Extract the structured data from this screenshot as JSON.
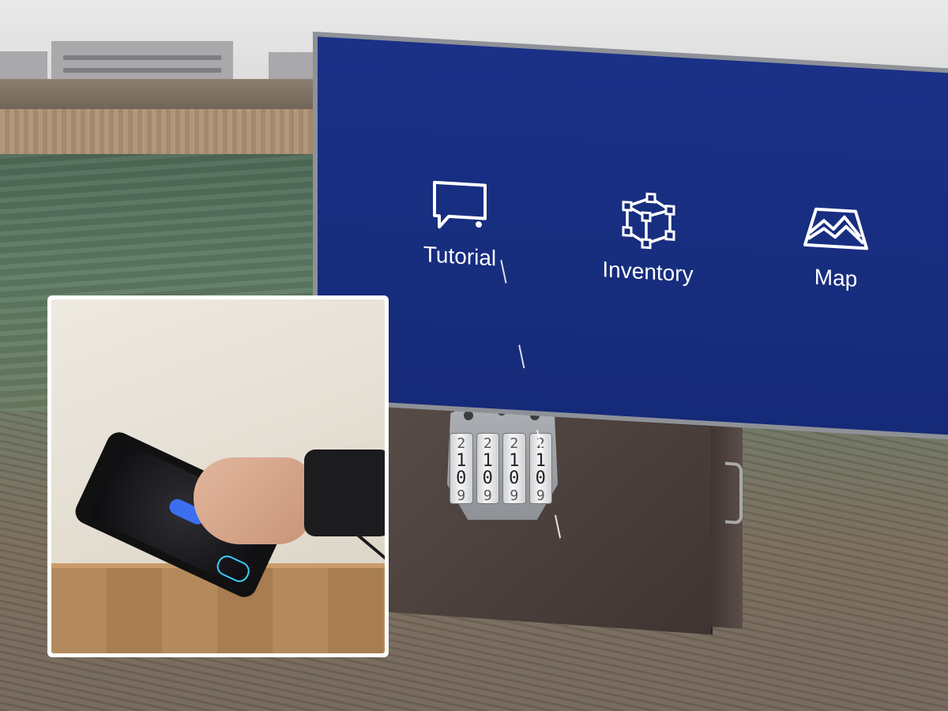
{
  "ar_menu": {
    "items": [
      {
        "label": "Tutorial",
        "icon": "speech-bubble-icon"
      },
      {
        "label": "Inventory",
        "icon": "cube-icon"
      },
      {
        "label": "Map",
        "icon": "map-icon"
      }
    ],
    "panel_color": "#1a3187"
  },
  "combination_lock": {
    "dial_top": [
      "2",
      "2",
      "2",
      "2"
    ],
    "dial_upper": [
      "1",
      "1",
      "1",
      "1"
    ],
    "dial_current": [
      "0",
      "0",
      "0",
      "0"
    ],
    "dial_bottom": [
      "9",
      "9",
      "9",
      "9"
    ]
  },
  "inset_photo": {
    "subject": "hand-holding-phone-controller"
  }
}
